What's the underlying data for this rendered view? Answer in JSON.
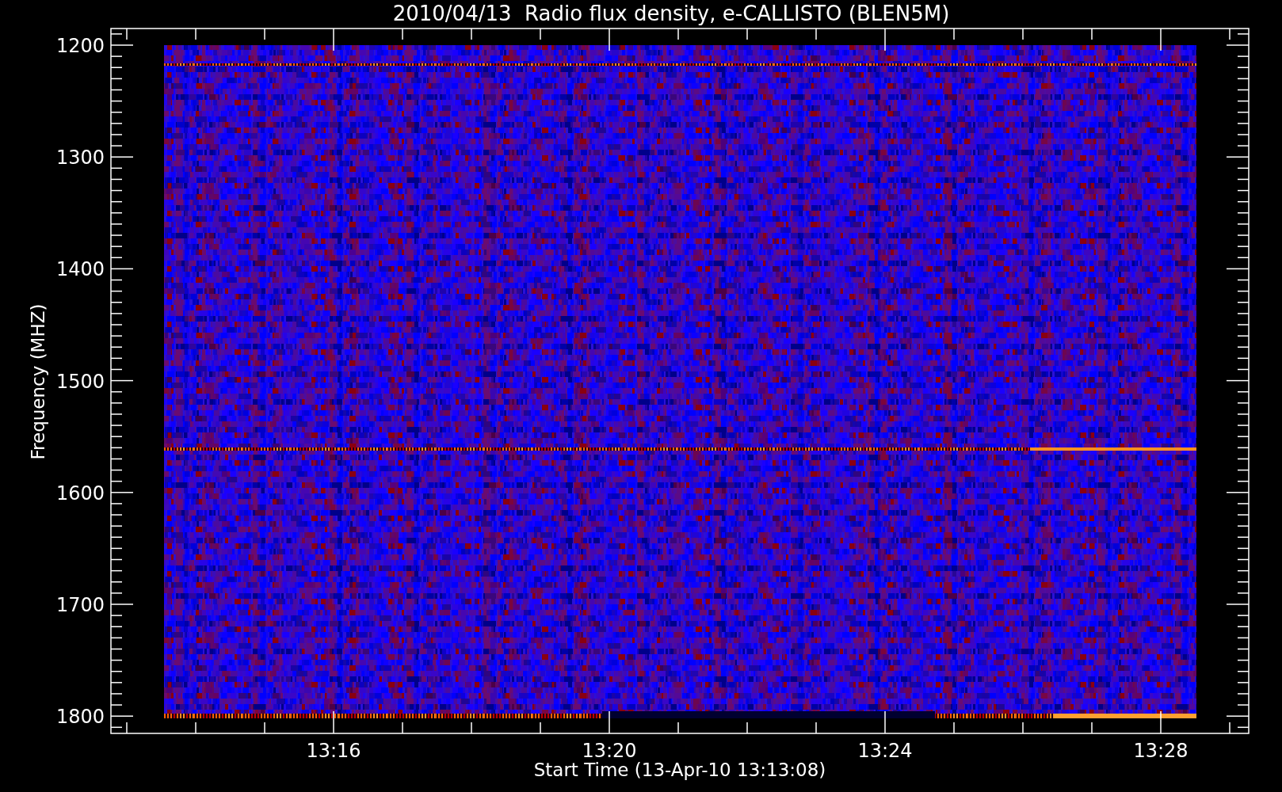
{
  "title": "2010/04/13  Radio flux density, e-CALLISTO (BLEN5M)",
  "y_axis": {
    "label": "Frequency (MHZ)",
    "ticks": [
      "1200",
      "1300",
      "1400",
      "1500",
      "1600",
      "1700",
      "1800"
    ]
  },
  "x_axis": {
    "label": "Start Time (13-Apr-10 13:13:08)",
    "ticks": [
      "13:16",
      "13:20",
      "13:24",
      "13:28"
    ]
  }
}
